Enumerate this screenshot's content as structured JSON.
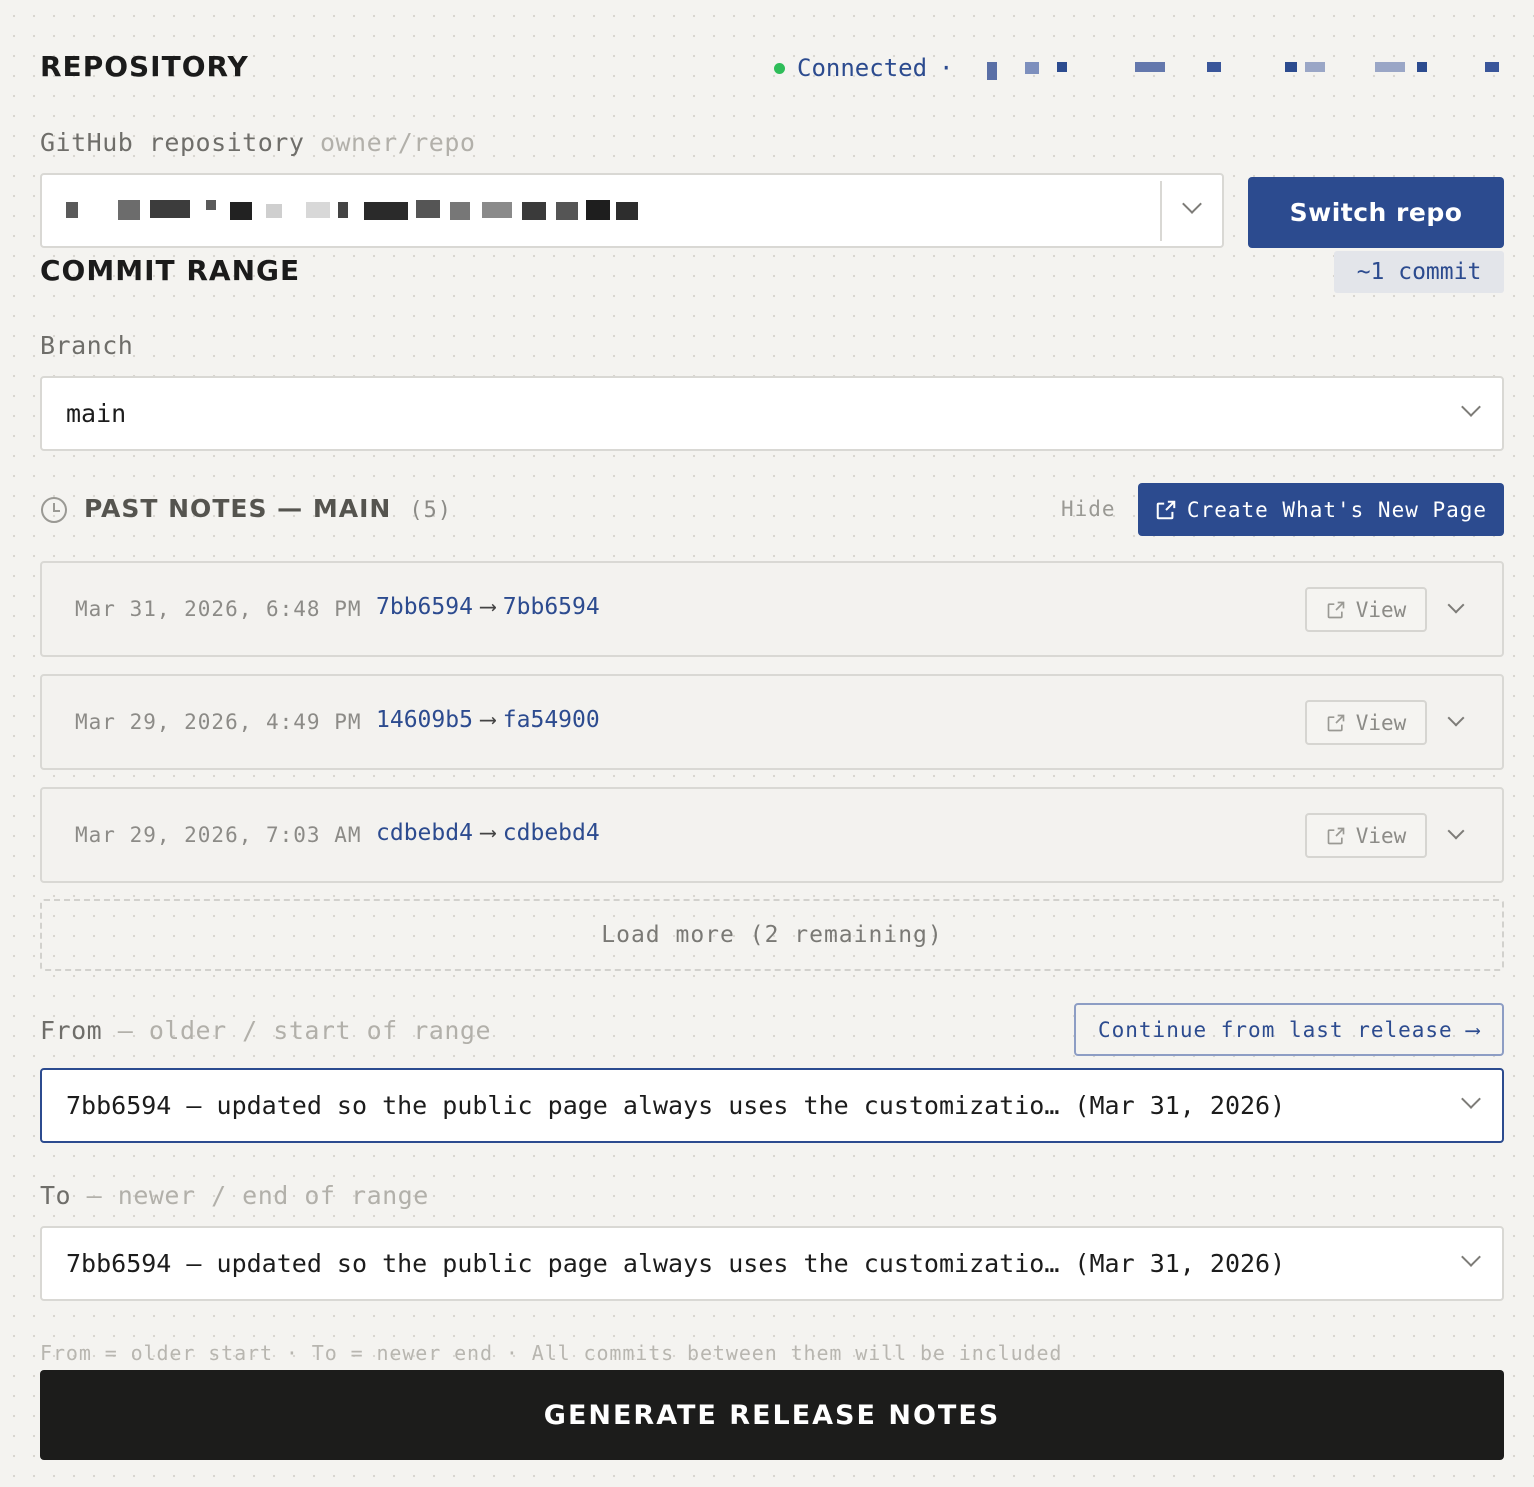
{
  "repository": {
    "heading": "REPOSITORY",
    "status_text": "Connected",
    "status_separator": "·",
    "status_color": "#2ebd59",
    "field_label": "GitHub repository",
    "field_hint": "owner/repo",
    "switch_button_label": "Switch repo",
    "accent_color": "#2c4b8f"
  },
  "commit_range": {
    "heading": "COMMIT RANGE",
    "commit_count_badge": "~1 commit",
    "branch_label": "Branch",
    "branch_value": "main"
  },
  "past_notes": {
    "icon": "clock-icon",
    "heading": "PAST NOTES — MAIN",
    "count": "(5)",
    "hide_label": "Hide",
    "create_page_label": "Create What's New Page",
    "create_page_icon": "external-link-icon",
    "items": [
      {
        "date": "Mar 31, 2026, 6:48 PM",
        "from": "7bb6594",
        "arrow": "⟶",
        "to": "7bb6594",
        "view_label": "View"
      },
      {
        "date": "Mar 29, 2026, 4:49 PM",
        "from": "14609b5",
        "arrow": "⟶",
        "to": "fa54900",
        "view_label": "View"
      },
      {
        "date": "Mar 29, 2026, 7:03 AM",
        "from": "cdbebd4",
        "arrow": "⟶",
        "to": "cdbebd4",
        "view_label": "View"
      }
    ],
    "load_more_label": "Load more (2 remaining)"
  },
  "range": {
    "from_label": "From",
    "from_hint": " — older / start of range",
    "continue_label": "Continue from last release ⟶",
    "from_value": "7bb6594 — updated so the public page always uses the customizatio… (Mar 31, 2026)",
    "to_label": "To",
    "to_hint": " — newer / end of range",
    "to_value": "7bb6594 — updated so the public page always uses the customizatio… (Mar 31, 2026)",
    "footnote": "From = older start · To = newer end · All commits between them will be included"
  },
  "generate_button_label": "GENERATE RELEASE NOTES"
}
